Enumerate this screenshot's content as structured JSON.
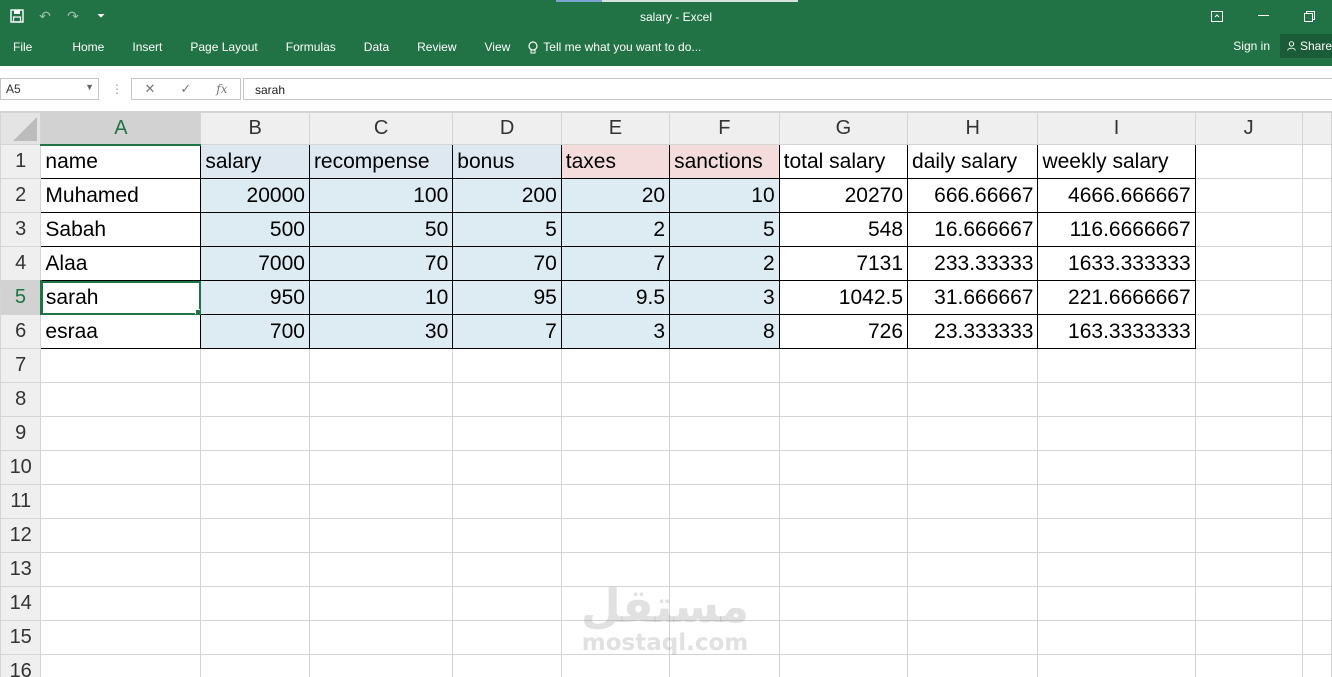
{
  "window": {
    "title": "salary - Excel",
    "controls": [
      "ribbon-display-icon",
      "minimize-icon",
      "restore-icon"
    ]
  },
  "quick_access": [
    "save-icon",
    "undo-icon",
    "redo-icon",
    "customize-icon"
  ],
  "ribbon": {
    "tabs": [
      "File",
      "Home",
      "Insert",
      "Page Layout",
      "Formulas",
      "Data",
      "Review",
      "View"
    ],
    "tell_me": "Tell me what you want to do...",
    "sign_in": "Sign in",
    "share": "Share"
  },
  "formula_bar": {
    "name_box": "A5",
    "fx_label": "fx",
    "value": "sarah"
  },
  "sheet": {
    "columns": [
      "A",
      "B",
      "C",
      "D",
      "E",
      "F",
      "G",
      "H",
      "I",
      "J"
    ],
    "active_cell": "A5",
    "row_numbers": [
      "1",
      "2",
      "3",
      "4",
      "5",
      "6",
      "7",
      "8",
      "9",
      "10",
      "11",
      "12",
      "13",
      "14",
      "15",
      "16"
    ],
    "header_row": [
      "name",
      "salary",
      "recompense",
      "bonus",
      "taxes",
      "sanctions",
      "total salary",
      "daily salary",
      "weekly salary"
    ],
    "rows": [
      [
        "Muhamed",
        "20000",
        "100",
        "200",
        "20",
        "10",
        "20270",
        "666.66667",
        "4666.666667"
      ],
      [
        "Sabah",
        "500",
        "50",
        "5",
        "2",
        "5",
        "548",
        "16.666667",
        "116.6666667"
      ],
      [
        "Alaa",
        "7000",
        "70",
        "70",
        "7",
        "2",
        "7131",
        "233.33333",
        "1633.333333"
      ],
      [
        "sarah",
        "950",
        "10",
        "95",
        "9.5",
        "3",
        "1042.5",
        "31.666667",
        "221.6666667"
      ],
      [
        "esraa",
        "700",
        "30",
        "7",
        "3",
        "8",
        "726",
        "23.333333",
        "163.3333333"
      ]
    ]
  },
  "colors": {
    "ribbon": "#217346",
    "header_blue": "#dde8f1",
    "header_pink": "#f5dcdc",
    "data_blue": "#ddebf2"
  },
  "watermark": {
    "logo": "مستقل",
    "url": "mostaql.com"
  }
}
